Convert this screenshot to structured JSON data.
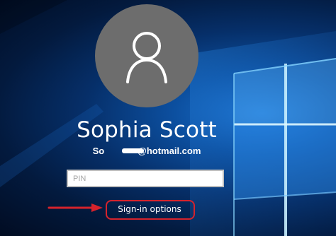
{
  "lock_screen": {
    "user_name": "Sophia Scott",
    "email_suffix": "@hotmail.com",
    "pin_placeholder": "PIN",
    "sign_in_options_label": "Sign-in options",
    "avatar_icon": "user-silhouette-icon",
    "annotation_color": "#d6232c",
    "accent_color": "#0c4f9f"
  }
}
